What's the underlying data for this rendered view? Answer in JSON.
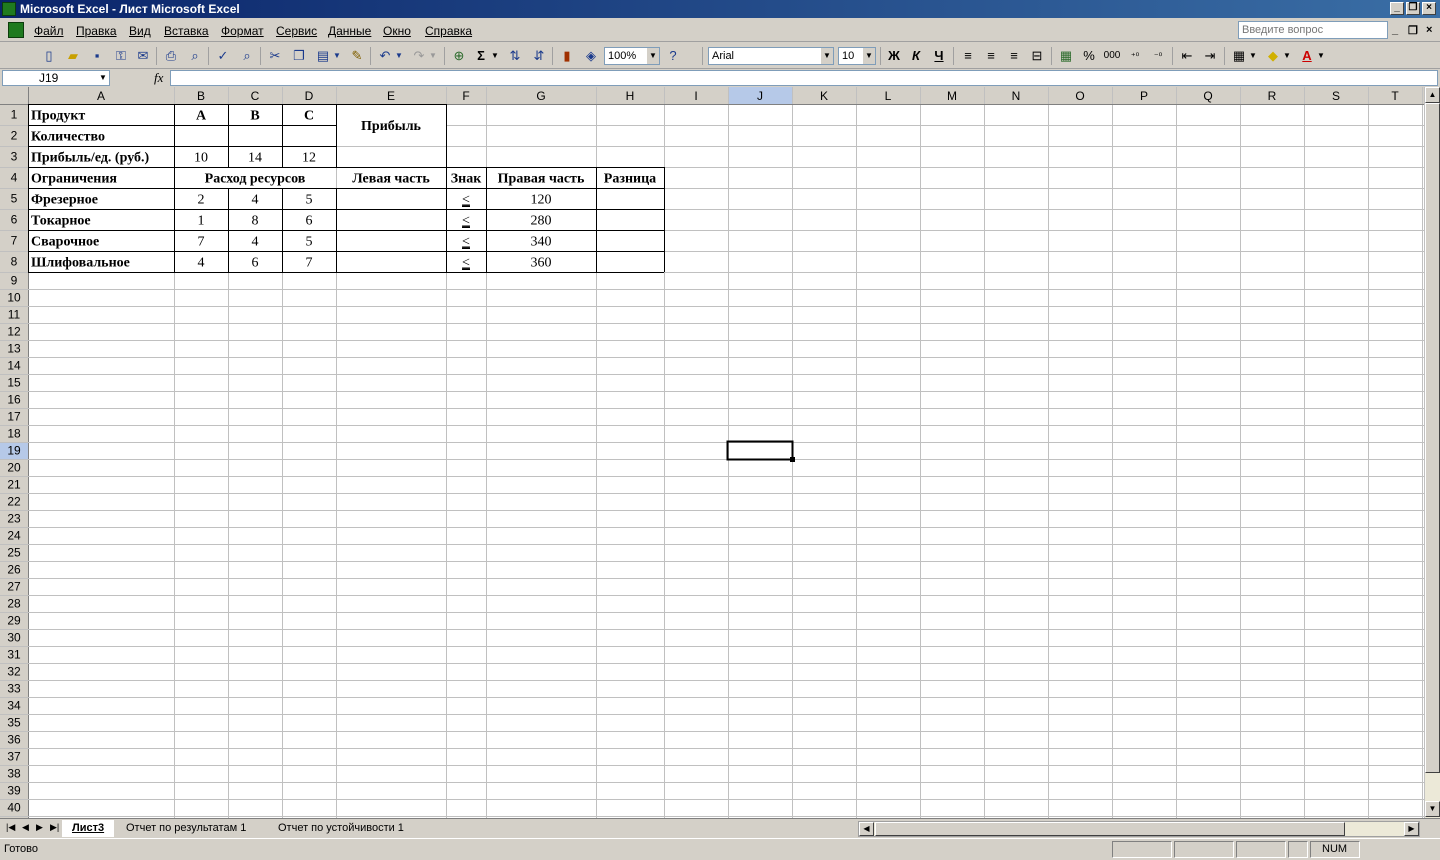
{
  "window": {
    "title": "Microsoft Excel - Лист Microsoft Excel",
    "question_placeholder": "Введите вопрос"
  },
  "menu": [
    "Файл",
    "Правка",
    "Вид",
    "Вставка",
    "Формат",
    "Сервис",
    "Данные",
    "Окно",
    "Справка"
  ],
  "toolbar": {
    "zoom": "100%",
    "font_name": "Arial",
    "font_size": "10",
    "bold": "Ж",
    "italic": "К",
    "underline": "Ч",
    "sum": "Σ",
    "percent": "%",
    "thousands": "000"
  },
  "formula_bar": {
    "name_box": "J19",
    "fx": "fx",
    "value": ""
  },
  "grid": {
    "columns": [
      "A",
      "B",
      "C",
      "D",
      "E",
      "F",
      "G",
      "H",
      "I",
      "J",
      "K",
      "L",
      "M",
      "N",
      "O",
      "P",
      "Q",
      "R",
      "S",
      "T"
    ],
    "selected_cell": "J19",
    "cells": [
      {
        "ref": "A1",
        "text": "Продукт",
        "bold": true,
        "align": "left"
      },
      {
        "ref": "B1",
        "text": "A",
        "bold": true,
        "align": "center"
      },
      {
        "ref": "C1",
        "text": "B",
        "bold": true,
        "align": "center"
      },
      {
        "ref": "D1",
        "text": "C",
        "bold": true,
        "align": "center"
      },
      {
        "ref": "E1",
        "text": "Прибыль",
        "bold": true,
        "align": "center",
        "rowspan": 2
      },
      {
        "ref": "A2",
        "text": "Количество",
        "bold": true,
        "align": "left"
      },
      {
        "ref": "A3",
        "text": "Прибыль/ед. (руб.)",
        "bold": true,
        "align": "left"
      },
      {
        "ref": "B3",
        "text": "10",
        "align": "center"
      },
      {
        "ref": "C3",
        "text": "14",
        "align": "center"
      },
      {
        "ref": "D3",
        "text": "12",
        "align": "center"
      },
      {
        "ref": "A4",
        "text": "Ограничения",
        "bold": true,
        "align": "left"
      },
      {
        "ref": "B4",
        "text": "Расход ресурсов",
        "bold": true,
        "align": "center",
        "colspan": 3
      },
      {
        "ref": "E4",
        "text": "Левая часть",
        "bold": true,
        "align": "center"
      },
      {
        "ref": "F4",
        "text": "Знак",
        "bold": true,
        "align": "center"
      },
      {
        "ref": "G4",
        "text": "Правая часть",
        "bold": true,
        "align": "center"
      },
      {
        "ref": "H4",
        "text": "Разница",
        "bold": true,
        "align": "center"
      },
      {
        "ref": "A5",
        "text": "Фрезерное",
        "bold": true,
        "align": "left"
      },
      {
        "ref": "B5",
        "text": "2",
        "align": "center"
      },
      {
        "ref": "C5",
        "text": "4",
        "align": "center"
      },
      {
        "ref": "D5",
        "text": "5",
        "align": "center"
      },
      {
        "ref": "F5",
        "text": "<",
        "align": "center",
        "underline": true
      },
      {
        "ref": "G5",
        "text": "120",
        "align": "center"
      },
      {
        "ref": "A6",
        "text": "Токарное",
        "bold": true,
        "align": "left"
      },
      {
        "ref": "B6",
        "text": "1",
        "align": "center"
      },
      {
        "ref": "C6",
        "text": "8",
        "align": "center"
      },
      {
        "ref": "D6",
        "text": "6",
        "align": "center"
      },
      {
        "ref": "F6",
        "text": "<",
        "align": "center",
        "underline": true
      },
      {
        "ref": "G6",
        "text": "280",
        "align": "center"
      },
      {
        "ref": "A7",
        "text": "Сварочное",
        "bold": true,
        "align": "left"
      },
      {
        "ref": "B7",
        "text": "7",
        "align": "center"
      },
      {
        "ref": "C7",
        "text": "4",
        "align": "center"
      },
      {
        "ref": "D7",
        "text": "5",
        "align": "center"
      },
      {
        "ref": "F7",
        "text": "<",
        "align": "center",
        "underline": true
      },
      {
        "ref": "G7",
        "text": "340",
        "align": "center"
      },
      {
        "ref": "A8",
        "text": "Шлифовальное",
        "bold": true,
        "align": "left"
      },
      {
        "ref": "B8",
        "text": "4",
        "align": "center"
      },
      {
        "ref": "C8",
        "text": "6",
        "align": "center"
      },
      {
        "ref": "D8",
        "text": "7",
        "align": "center"
      },
      {
        "ref": "F8",
        "text": "<",
        "align": "center",
        "underline": true
      },
      {
        "ref": "G8",
        "text": "360",
        "align": "center"
      }
    ]
  },
  "sheets": [
    {
      "name": "Лист3",
      "active": true
    },
    {
      "name": "Отчет по результатам 1",
      "active": false
    },
    {
      "name": "Отчет по устойчивости 1",
      "active": false
    }
  ],
  "status": {
    "text": "Готово",
    "num": "NUM"
  },
  "colors": {
    "header_bg": "#d4d0c8",
    "selected_header_bg": "#b6c9e8",
    "grid_line": "#c0c0c0",
    "border": "#000000"
  }
}
